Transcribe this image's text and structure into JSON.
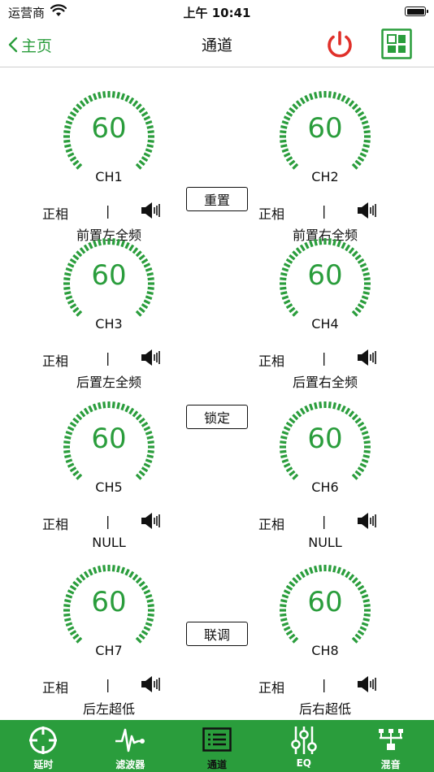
{
  "status_bar": {
    "carrier": "运营商",
    "time": "上午 10:41"
  },
  "nav": {
    "back_label": "主页",
    "title": "通道",
    "power_color": "#e0302a",
    "accent": "#2a9d3c"
  },
  "channels": [
    {
      "value": "60",
      "label": "CH1",
      "phase": "正相",
      "divider": "|",
      "name": "前置左全频"
    },
    {
      "value": "60",
      "label": "CH2",
      "phase": "正相",
      "divider": "|",
      "name": "前置右全频"
    },
    {
      "value": "60",
      "label": "CH3",
      "phase": "正相",
      "divider": "|",
      "name": "后置左全频"
    },
    {
      "value": "60",
      "label": "CH4",
      "phase": "正相",
      "divider": "|",
      "name": "后置右全频"
    },
    {
      "value": "60",
      "label": "CH5",
      "phase": "正相",
      "divider": "|",
      "name": "NULL"
    },
    {
      "value": "60",
      "label": "CH6",
      "phase": "正相",
      "divider": "|",
      "name": "NULL"
    },
    {
      "value": "60",
      "label": "CH7",
      "phase": "正相",
      "divider": "|",
      "name": "后左超低"
    },
    {
      "value": "60",
      "label": "CH8",
      "phase": "正相",
      "divider": "|",
      "name": "后右超低"
    }
  ],
  "buttons": {
    "reset": "重置",
    "lock": "锁定",
    "link": "联调"
  },
  "tabbar": [
    {
      "label": "延时",
      "icon": "crosshair-icon"
    },
    {
      "label": "滤波器",
      "icon": "waveform-icon"
    },
    {
      "label": "通道",
      "icon": "channel-list-icon"
    },
    {
      "label": "EQ",
      "icon": "sliders-icon"
    },
    {
      "label": "混音",
      "icon": "network-icon"
    }
  ]
}
